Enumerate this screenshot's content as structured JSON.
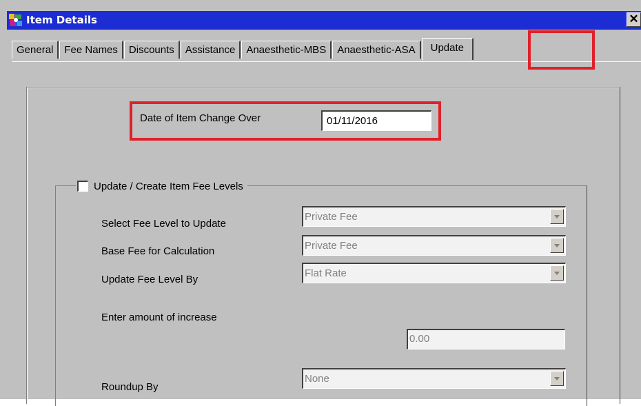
{
  "window": {
    "title": "Item Details",
    "close_label": "✕"
  },
  "tabs": [
    {
      "label": "General"
    },
    {
      "label": "Fee Names"
    },
    {
      "label": "Discounts"
    },
    {
      "label": "Assistance"
    },
    {
      "label": "Anaesthetic-MBS"
    },
    {
      "label": "Anaesthetic-ASA"
    },
    {
      "label": "Update",
      "active": true
    }
  ],
  "changeover": {
    "label": "Date of Item Change Over",
    "value": "01/11/2016"
  },
  "fee_levels": {
    "checkbox_label": "Update / Create Item Fee Levels",
    "checked": false,
    "select_fee_level_label": "Select Fee Level to Update",
    "select_fee_level_value": "Private Fee",
    "base_fee_label": "Base Fee for Calculation",
    "base_fee_value": "Private Fee",
    "update_by_label": "Update Fee Level By",
    "update_by_value": "Flat Rate",
    "increase_label": "Enter amount of increase",
    "increase_value": "0.00",
    "roundup_label": "Roundup By",
    "roundup_value": "None"
  },
  "colors": {
    "titlebar": "#1c2dd3",
    "highlight": "#e0202a",
    "face": "#c0c0c0"
  }
}
